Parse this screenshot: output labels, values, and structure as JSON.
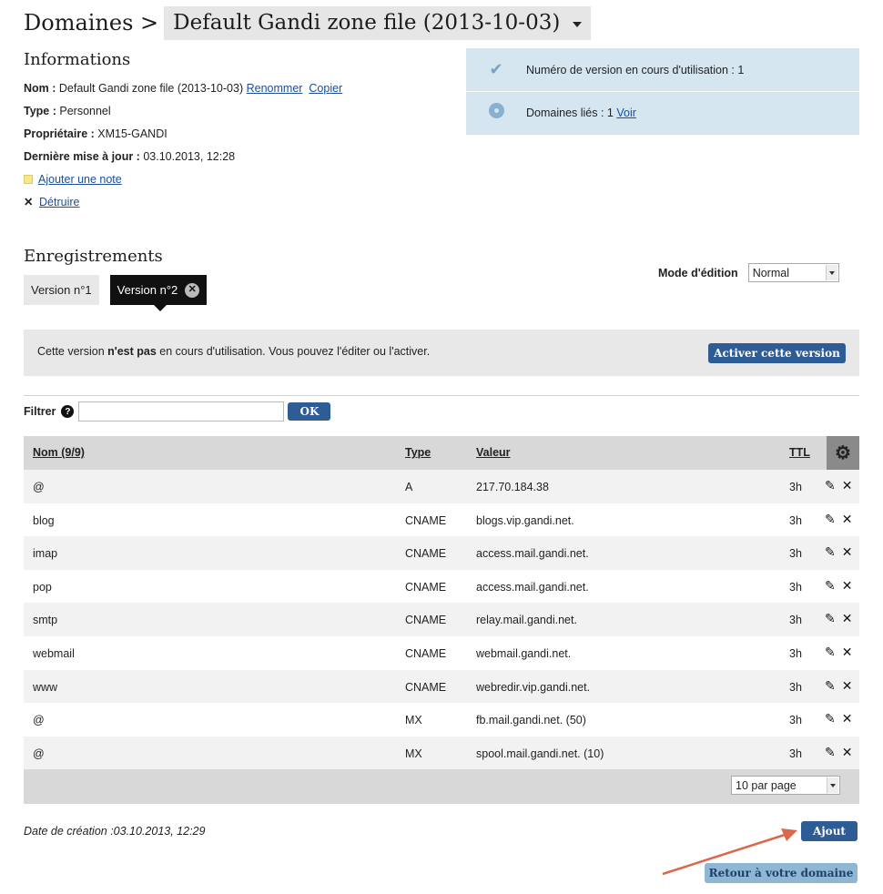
{
  "header": {
    "prefix": "Domaines >",
    "zone_name": "Default Gandi zone file (2013-10-03)"
  },
  "informations": {
    "title": "Informations",
    "name_label": "Nom :",
    "name_value": "Default Gandi zone file (2013-10-03)",
    "rename_link": "Renommer",
    "copy_link": "Copier",
    "type_label": "Type :",
    "type_value": "Personnel",
    "owner_label": "Propriétaire :",
    "owner_value": "XM15-GANDI",
    "updated_label": "Dernière mise à jour :",
    "updated_value": "03.10.2013, 12:28",
    "add_note_link": "Ajouter une note",
    "destroy_link": "Détruire"
  },
  "status": {
    "version_text": "Numéro de version en cours d'utilisation : 1",
    "linked_text": "Domaines liés : 1",
    "view_link": "Voir"
  },
  "records": {
    "title": "Enregistrements",
    "tabs": [
      {
        "label": "Version n°1"
      },
      {
        "label": "Version n°2"
      }
    ],
    "mode_label": "Mode d'édition",
    "mode_value": "Normal",
    "notice_before": "Cette version ",
    "notice_bold": "n'est pas",
    "notice_after": " en cours d'utilisation. Vous pouvez l'éditer ou l'activer.",
    "activate_button": "Activer cette version",
    "filter_label": "Filtrer",
    "filter_value": "",
    "ok_button": "OK"
  },
  "table": {
    "col_name": "Nom",
    "col_name_count": "(9/9)",
    "col_type": "Type",
    "col_value": "Valeur",
    "col_ttl": "TTL",
    "rows": [
      {
        "name": "@",
        "type": "A",
        "value": "217.70.184.38",
        "ttl": "3h"
      },
      {
        "name": "blog",
        "type": "CNAME",
        "value": "blogs.vip.gandi.net.",
        "ttl": "3h"
      },
      {
        "name": "imap",
        "type": "CNAME",
        "value": "access.mail.gandi.net.",
        "ttl": "3h"
      },
      {
        "name": "pop",
        "type": "CNAME",
        "value": "access.mail.gandi.net.",
        "ttl": "3h"
      },
      {
        "name": "smtp",
        "type": "CNAME",
        "value": "relay.mail.gandi.net.",
        "ttl": "3h"
      },
      {
        "name": "webmail",
        "type": "CNAME",
        "value": "webmail.gandi.net.",
        "ttl": "3h"
      },
      {
        "name": "www",
        "type": "CNAME",
        "value": "webredir.vip.gandi.net.",
        "ttl": "3h"
      },
      {
        "name": "@",
        "type": "MX",
        "value": "fb.mail.gandi.net. (50)",
        "ttl": "3h"
      },
      {
        "name": "@",
        "type": "MX",
        "value": "spool.mail.gandi.net. (10)",
        "ttl": "3h"
      }
    ],
    "per_page": "10 par page"
  },
  "footer": {
    "created_text": "Date de création :03.10.2013, 12:29",
    "add_button": "Ajout",
    "return_button": "Retour à votre domaine"
  },
  "colors": {
    "accent": "#2d5d94",
    "status_bg": "#d5e6f1",
    "annotation_arrow": "#d9694a"
  },
  "icons": [
    "chevron-down-icon",
    "checkmark-icon",
    "disc-icon",
    "note-icon",
    "close-icon",
    "help-icon",
    "gear-icon",
    "pencil-icon"
  ]
}
